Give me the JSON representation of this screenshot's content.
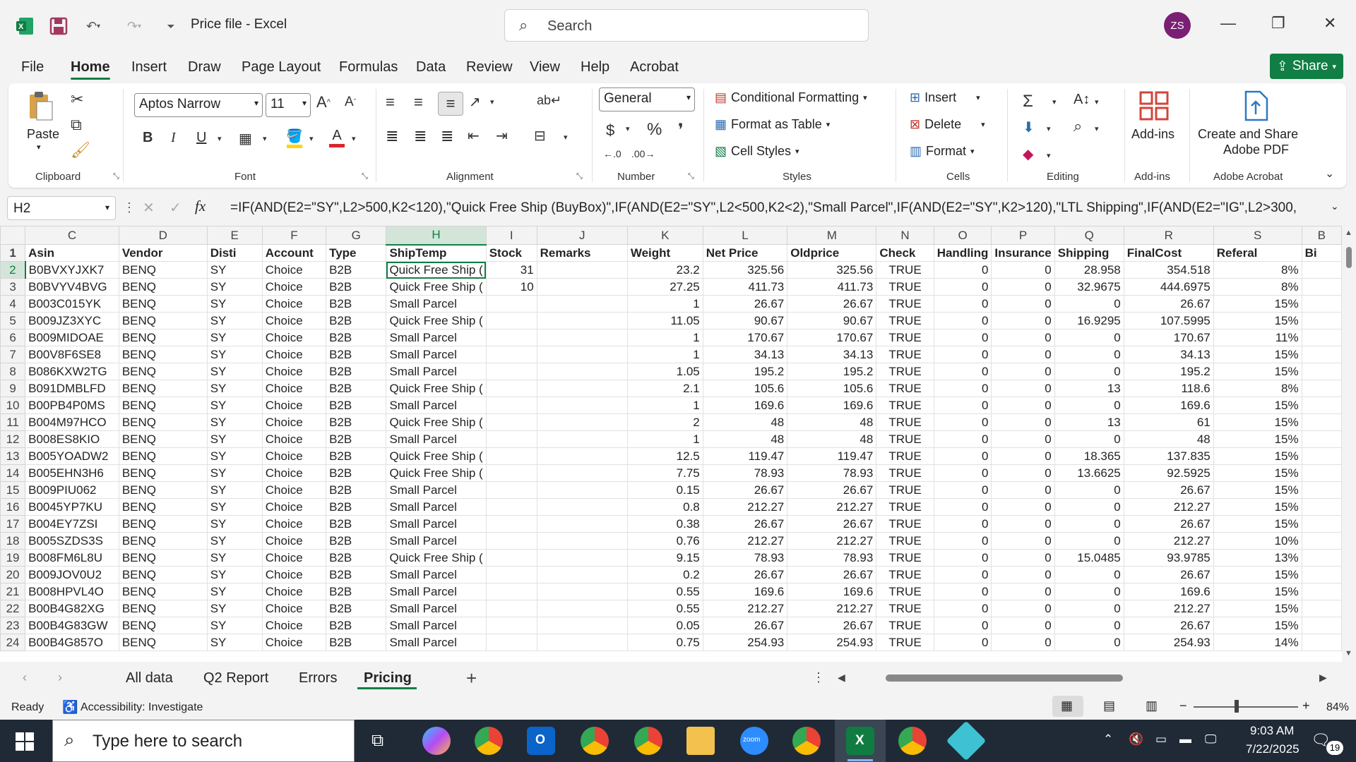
{
  "window": {
    "title": "Price file  -  Excel",
    "search_placeholder": "Search",
    "user_initials": "ZS"
  },
  "menu": [
    "File",
    "Home",
    "Insert",
    "Draw",
    "Page Layout",
    "Formulas",
    "Data",
    "Review",
    "View",
    "Help",
    "Acrobat"
  ],
  "share_label": "Share",
  "ribbon": {
    "clipboard": {
      "paste": "Paste",
      "label": "Clipboard"
    },
    "font": {
      "name": "Aptos Narrow",
      "size": "11",
      "label": "Font"
    },
    "alignment": {
      "label": "Alignment"
    },
    "number": {
      "format": "General",
      "label": "Number"
    },
    "styles": {
      "conditional": "Conditional Formatting",
      "table": "Format as Table",
      "cell": "Cell Styles",
      "label": "Styles"
    },
    "cells": {
      "insert": "Insert",
      "delete": "Delete",
      "format": "Format",
      "label": "Cells"
    },
    "editing": {
      "label": "Editing"
    },
    "addins": {
      "btn": "Add-ins",
      "label": "Add-ins"
    },
    "acrobat": {
      "btn1": "Create and Share",
      "btn2": "Adobe PDF",
      "label": "Adobe Acrobat"
    }
  },
  "formula_bar": {
    "name_box": "H2",
    "fx": "fx",
    "formula": "=IF(AND(E2=\"SY\",L2>500,K2<120),\"Quick Free Ship (BuyBox)\",IF(AND(E2=\"SY\",L2<500,K2<2),\"Small Parcel\",IF(AND(E2=\"SY\",K2>120),\"LTL Shipping\",IF(AND(E2=\"IG\",L2>300,"
  },
  "columns": [
    "C",
    "D",
    "E",
    "F",
    "G",
    "H",
    "I",
    "J",
    "K",
    "L",
    "M",
    "N",
    "O",
    "P",
    "Q",
    "R",
    "S",
    "B"
  ],
  "headers": [
    "Asin",
    "Vendor",
    "Disti",
    "Account",
    "Type",
    "ShipTemp",
    "Stock",
    "Remarks",
    "Weight",
    "Net Price",
    "Oldprice",
    "Check",
    "Handling",
    "Insurance",
    "Shipping",
    "FinalCost",
    "Referal",
    "Bi"
  ],
  "rows": [
    [
      "2",
      "B0BVXYJXK7",
      "BENQ",
      "SY",
      "Choice",
      "B2B",
      "Quick Free Ship (",
      "31",
      "",
      "23.2",
      "325.56",
      "325.56",
      "TRUE",
      "0",
      "0",
      "28.958",
      "354.518",
      "8%"
    ],
    [
      "3",
      "B0BVYV4BVG",
      "BENQ",
      "SY",
      "Choice",
      "B2B",
      "Quick Free Ship (",
      "10",
      "",
      "27.25",
      "411.73",
      "411.73",
      "TRUE",
      "0",
      "0",
      "32.9675",
      "444.6975",
      "8%"
    ],
    [
      "4",
      "B003C015YK",
      "BENQ",
      "SY",
      "Choice",
      "B2B",
      "Small Parcel",
      "",
      "",
      "1",
      "26.67",
      "26.67",
      "TRUE",
      "0",
      "0",
      "0",
      "26.67",
      "15%"
    ],
    [
      "5",
      "B009JZ3XYC",
      "BENQ",
      "SY",
      "Choice",
      "B2B",
      "Quick Free Ship (",
      "",
      "",
      "11.05",
      "90.67",
      "90.67",
      "TRUE",
      "0",
      "0",
      "16.9295",
      "107.5995",
      "15%"
    ],
    [
      "6",
      "B009MIDOAE",
      "BENQ",
      "SY",
      "Choice",
      "B2B",
      "Small Parcel",
      "",
      "",
      "1",
      "170.67",
      "170.67",
      "TRUE",
      "0",
      "0",
      "0",
      "170.67",
      "11%"
    ],
    [
      "7",
      "B00V8F6SE8",
      "BENQ",
      "SY",
      "Choice",
      "B2B",
      "Small Parcel",
      "",
      "",
      "1",
      "34.13",
      "34.13",
      "TRUE",
      "0",
      "0",
      "0",
      "34.13",
      "15%"
    ],
    [
      "8",
      "B086KXW2TG",
      "BENQ",
      "SY",
      "Choice",
      "B2B",
      "Small Parcel",
      "",
      "",
      "1.05",
      "195.2",
      "195.2",
      "TRUE",
      "0",
      "0",
      "0",
      "195.2",
      "15%"
    ],
    [
      "9",
      "B091DMBLFD",
      "BENQ",
      "SY",
      "Choice",
      "B2B",
      "Quick Free Ship (",
      "",
      "",
      "2.1",
      "105.6",
      "105.6",
      "TRUE",
      "0",
      "0",
      "13",
      "118.6",
      "8%"
    ],
    [
      "10",
      "B00PB4P0MS",
      "BENQ",
      "SY",
      "Choice",
      "B2B",
      "Small Parcel",
      "",
      "",
      "1",
      "169.6",
      "169.6",
      "TRUE",
      "0",
      "0",
      "0",
      "169.6",
      "15%"
    ],
    [
      "11",
      "B004M97HCO",
      "BENQ",
      "SY",
      "Choice",
      "B2B",
      "Quick Free Ship (",
      "",
      "",
      "2",
      "48",
      "48",
      "TRUE",
      "0",
      "0",
      "13",
      "61",
      "15%"
    ],
    [
      "12",
      "B008ES8KIO",
      "BENQ",
      "SY",
      "Choice",
      "B2B",
      "Small Parcel",
      "",
      "",
      "1",
      "48",
      "48",
      "TRUE",
      "0",
      "0",
      "0",
      "48",
      "15%"
    ],
    [
      "13",
      "B005YOADW2",
      "BENQ",
      "SY",
      "Choice",
      "B2B",
      "Quick Free Ship (",
      "",
      "",
      "12.5",
      "119.47",
      "119.47",
      "TRUE",
      "0",
      "0",
      "18.365",
      "137.835",
      "15%"
    ],
    [
      "14",
      "B005EHN3H6",
      "BENQ",
      "SY",
      "Choice",
      "B2B",
      "Quick Free Ship (",
      "",
      "",
      "7.75",
      "78.93",
      "78.93",
      "TRUE",
      "0",
      "0",
      "13.6625",
      "92.5925",
      "15%"
    ],
    [
      "15",
      "B009PIU062",
      "BENQ",
      "SY",
      "Choice",
      "B2B",
      "Small Parcel",
      "",
      "",
      "0.15",
      "26.67",
      "26.67",
      "TRUE",
      "0",
      "0",
      "0",
      "26.67",
      "15%"
    ],
    [
      "16",
      "B0045YP7KU",
      "BENQ",
      "SY",
      "Choice",
      "B2B",
      "Small Parcel",
      "",
      "",
      "0.8",
      "212.27",
      "212.27",
      "TRUE",
      "0",
      "0",
      "0",
      "212.27",
      "15%"
    ],
    [
      "17",
      "B004EY7ZSI",
      "BENQ",
      "SY",
      "Choice",
      "B2B",
      "Small Parcel",
      "",
      "",
      "0.38",
      "26.67",
      "26.67",
      "TRUE",
      "0",
      "0",
      "0",
      "26.67",
      "15%"
    ],
    [
      "18",
      "B005SZDS3S",
      "BENQ",
      "SY",
      "Choice",
      "B2B",
      "Small Parcel",
      "",
      "",
      "0.76",
      "212.27",
      "212.27",
      "TRUE",
      "0",
      "0",
      "0",
      "212.27",
      "10%"
    ],
    [
      "19",
      "B008FM6L8U",
      "BENQ",
      "SY",
      "Choice",
      "B2B",
      "Quick Free Ship (",
      "",
      "",
      "9.15",
      "78.93",
      "78.93",
      "TRUE",
      "0",
      "0",
      "15.0485",
      "93.9785",
      "13%"
    ],
    [
      "20",
      "B009JOV0U2",
      "BENQ",
      "SY",
      "Choice",
      "B2B",
      "Small Parcel",
      "",
      "",
      "0.2",
      "26.67",
      "26.67",
      "TRUE",
      "0",
      "0",
      "0",
      "26.67",
      "15%"
    ],
    [
      "21",
      "B008HPVL4O",
      "BENQ",
      "SY",
      "Choice",
      "B2B",
      "Small Parcel",
      "",
      "",
      "0.55",
      "169.6",
      "169.6",
      "TRUE",
      "0",
      "0",
      "0",
      "169.6",
      "15%"
    ],
    [
      "22",
      "B00B4G82XG",
      "BENQ",
      "SY",
      "Choice",
      "B2B",
      "Small Parcel",
      "",
      "",
      "0.55",
      "212.27",
      "212.27",
      "TRUE",
      "0",
      "0",
      "0",
      "212.27",
      "15%"
    ],
    [
      "23",
      "B00B4G83GW",
      "BENQ",
      "SY",
      "Choice",
      "B2B",
      "Small Parcel",
      "",
      "",
      "0.05",
      "26.67",
      "26.67",
      "TRUE",
      "0",
      "0",
      "0",
      "26.67",
      "15%"
    ],
    [
      "24",
      "B00B4G857O",
      "BENQ",
      "SY",
      "Choice",
      "B2B",
      "Small Parcel",
      "",
      "",
      "0.75",
      "254.93",
      "254.93",
      "TRUE",
      "0",
      "0",
      "0",
      "254.93",
      "14%"
    ]
  ],
  "sheet_tabs": [
    "All data",
    "Q2 Report",
    "Errors",
    "Pricing"
  ],
  "active_sheet": "Pricing",
  "status": {
    "ready": "Ready",
    "accessibility": "Accessibility: Investigate",
    "zoom": "84%"
  },
  "taskbar": {
    "search_placeholder": "Type here to search",
    "time": "9:03 AM",
    "date": "7/22/2025",
    "notifications": "19"
  },
  "colors": {
    "excel_green": "#117e45",
    "taskbar": "#1f2a36"
  }
}
